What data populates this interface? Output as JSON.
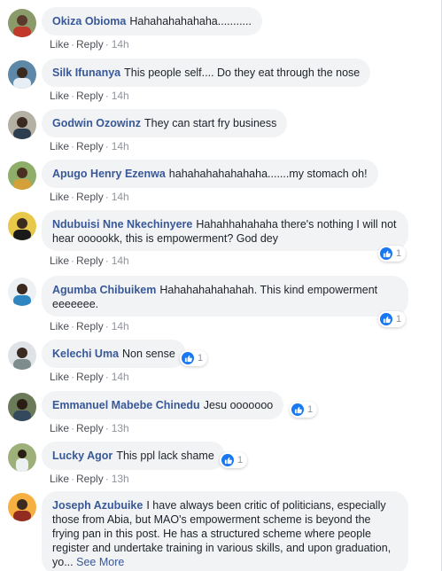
{
  "actions": {
    "like": "Like",
    "reply": "Reply",
    "separator": "·"
  },
  "colors": {
    "author": "#385898",
    "bubble": "#f2f3f5",
    "like_badge": "#1877f2"
  },
  "comments": [
    {
      "author": "Okiza Obioma",
      "text": "Hahahahahahaha...........",
      "time": "14h",
      "reactions": null,
      "avatar": "avatar-icon"
    },
    {
      "author": "Silk Ifunanya",
      "text": "This people self.... Do they eat through the nose",
      "time": "14h",
      "reactions": null,
      "avatar": "avatar-icon"
    },
    {
      "author": "Godwin Ozowinz",
      "text": "They can start fry business",
      "time": "14h",
      "reactions": null,
      "avatar": "avatar-icon"
    },
    {
      "author": "Apugo Henry Ezenwa",
      "text": "hahahahahahahaha.......my stomach oh!",
      "time": "14h",
      "reactions": null,
      "avatar": "avatar-icon"
    },
    {
      "author": "Ndubuisi Nne Nkechinyere",
      "text": "Hahahhahahaha there's nothing I will not hear oooookk, this is empowerment? God dey",
      "time": "14h",
      "reactions": "1",
      "avatar": "avatar-icon"
    },
    {
      "author": "Agumba Chibuikem",
      "text": "Hahahahahahahah. This kind empowerment eeeeeee.",
      "time": "14h",
      "reactions": "1",
      "avatar": "avatar-icon"
    },
    {
      "author": "Kelechi Uma",
      "text": "Non sense",
      "time": "14h",
      "reactions": "1",
      "avatar": "avatar-icon"
    },
    {
      "author": "Emmanuel Mabebe Chinedu",
      "text": "Jesu ooooooo",
      "time": "13h",
      "reactions": "1",
      "avatar": "avatar-icon"
    },
    {
      "author": "Lucky Agor",
      "text": "This ppl lack shame",
      "time": "13h",
      "reactions": "1",
      "avatar": "avatar-icon"
    },
    {
      "author": "Joseph Azubuike",
      "text": "I have always been critic of politicians, especially those from Abia, but MAO's empowerment scheme is beyond the frying pan in this post. He has a structured scheme where people register and undertake training in various skills, and upon graduation, yo...",
      "see_more": "See More",
      "time": null,
      "reactions": null,
      "avatar": "avatar-icon"
    }
  ]
}
